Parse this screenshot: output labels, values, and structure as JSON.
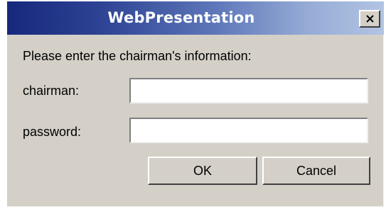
{
  "dialog": {
    "title": "WebPresentation",
    "prompt": "Please enter the chairman's information:",
    "fields": {
      "chairman": {
        "label": "chairman:",
        "value": ""
      },
      "password": {
        "label": "password:",
        "value": ""
      }
    },
    "buttons": {
      "ok_label": "OK",
      "cancel_label": "Cancel"
    },
    "icons": {
      "close": "close-icon"
    },
    "colors": {
      "titlebar_start": "#16287c",
      "titlebar_end": "#b2c4e3",
      "face": "#d4d0c8"
    }
  }
}
